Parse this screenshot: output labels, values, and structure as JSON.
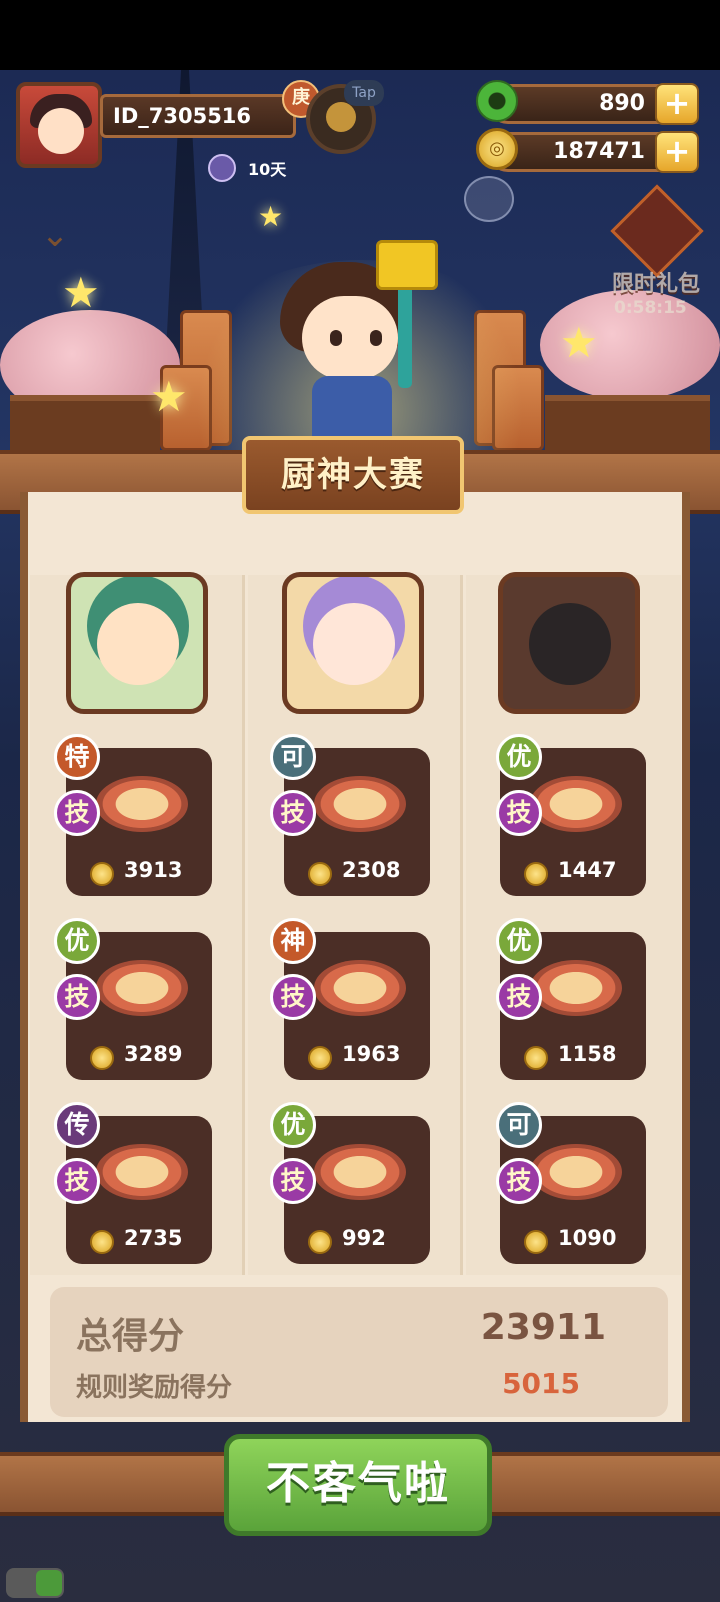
{
  "player": {
    "id": "ID_7305516",
    "badge": "庚",
    "tap_label": "Tap",
    "days": "10天"
  },
  "resources": {
    "jade": "890",
    "coins": "187471"
  },
  "gift": {
    "label": "限时礼包",
    "timer": "0:58:15"
  },
  "contest": {
    "title": "厨神大赛"
  },
  "columns": [
    {
      "name": "chef-1",
      "dishes": [
        {
          "grade": "特",
          "skill": "技",
          "score": "3913"
        },
        {
          "grade": "优",
          "skill": "技",
          "score": "3289"
        },
        {
          "grade": "传",
          "skill": "技",
          "score": "2735"
        }
      ]
    },
    {
      "name": "chef-2",
      "dishes": [
        {
          "grade": "可",
          "skill": "技",
          "score": "2308"
        },
        {
          "grade": "神",
          "skill": "技",
          "score": "1963"
        },
        {
          "grade": "优",
          "skill": "技",
          "score": "992"
        }
      ]
    },
    {
      "name": "chef-3",
      "dishes": [
        {
          "grade": "优",
          "skill": "技",
          "score": "1447"
        },
        {
          "grade": "优",
          "skill": "技",
          "score": "1158"
        },
        {
          "grade": "可",
          "skill": "技",
          "score": "1090"
        }
      ]
    }
  ],
  "summary": {
    "total_label": "总得分",
    "total_value": "23911",
    "bonus_label": "规则奖励得分",
    "bonus_value": "5015"
  },
  "confirm_button": "不客气啦",
  "colors": {
    "grade_te": "#c4592a",
    "grade_you": "#7aa83a",
    "grade_ke": "#4a6f7a",
    "grade_shen": "#c4592a",
    "grade_chuan": "#6a3a7a",
    "skill": "#9a3aa5"
  }
}
